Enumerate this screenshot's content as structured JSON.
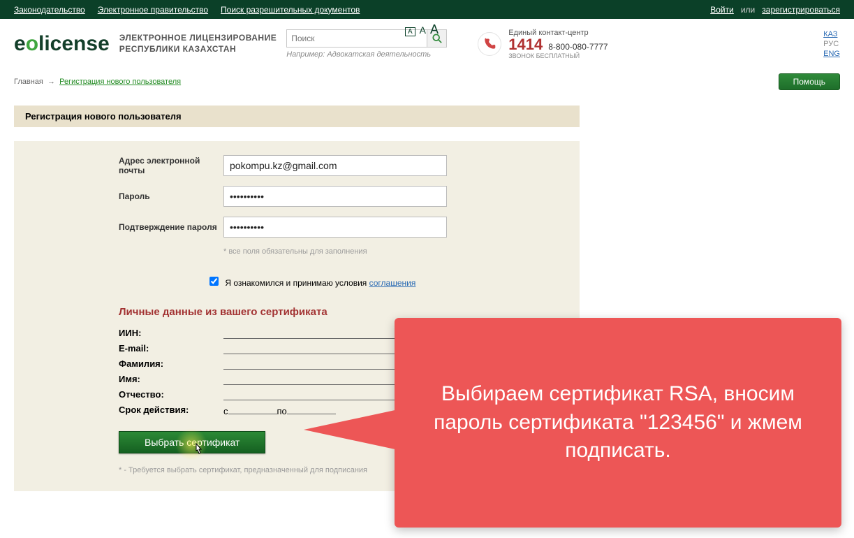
{
  "topbar": {
    "left": [
      "Законодательство",
      "Электронное правительство",
      "Поиск разрешительных документов"
    ],
    "login": "Войти",
    "or": "или",
    "register": "зарегистрироваться"
  },
  "header": {
    "logo_part1": "e",
    "logo_dot_tag": "о",
    "logo_part2": "license",
    "sublogo_line1": "ЭЛЕКТРОННОЕ ЛИЦЕНЗИРОВАНИЕ",
    "sublogo_line2": "РЕСПУБЛИКИ КАЗАХСТАН",
    "search_placeholder": "Поиск",
    "search_example": "Например: Адвокатская деятельность",
    "fontsize_a": "A",
    "contact": {
      "title": "Единый контакт-центр",
      "number": "1414",
      "toll": "8-800-080-7777",
      "free": "ЗВОНОК БЕСПЛАТНЫЙ"
    },
    "langs": {
      "kaz": "КАЗ",
      "rus": "РУС",
      "eng": "ENG"
    }
  },
  "breadcrumb": {
    "home": "Главная",
    "current": "Регистрация нового пользователя",
    "help": "Помощь"
  },
  "page": {
    "title": "Регистрация нового пользователя"
  },
  "form": {
    "email_label": "Адрес электронной почты",
    "email_value": "pokompu.kz@gmail.com",
    "pwd_label": "Пароль",
    "pwd_value": "••••••••••",
    "pwd2_label": "Подтверждение пароля",
    "pwd2_value": "••••••••••",
    "required_note": "* все поля обязательны для заполнения",
    "agree_text": "Я ознакомился и принимаю условия ",
    "agree_link": "соглашения",
    "cert": {
      "title": "Личные данные из вашего сертификата",
      "iin": "ИИН:",
      "email": "E-mail:",
      "lastname": "Фамилия:",
      "firstname": "Имя:",
      "patronym": "Отчество:",
      "validity": "Срок действия:",
      "from": "с",
      "to": "по",
      "choose": "Выбрать сертификат",
      "note": "* - Требуется выбрать сертификат, предназначенный для подписания"
    }
  },
  "callout": {
    "text": "Выбираем сертификат RSA, вносим пароль сертификата \"123456\" и жмем подписать."
  }
}
